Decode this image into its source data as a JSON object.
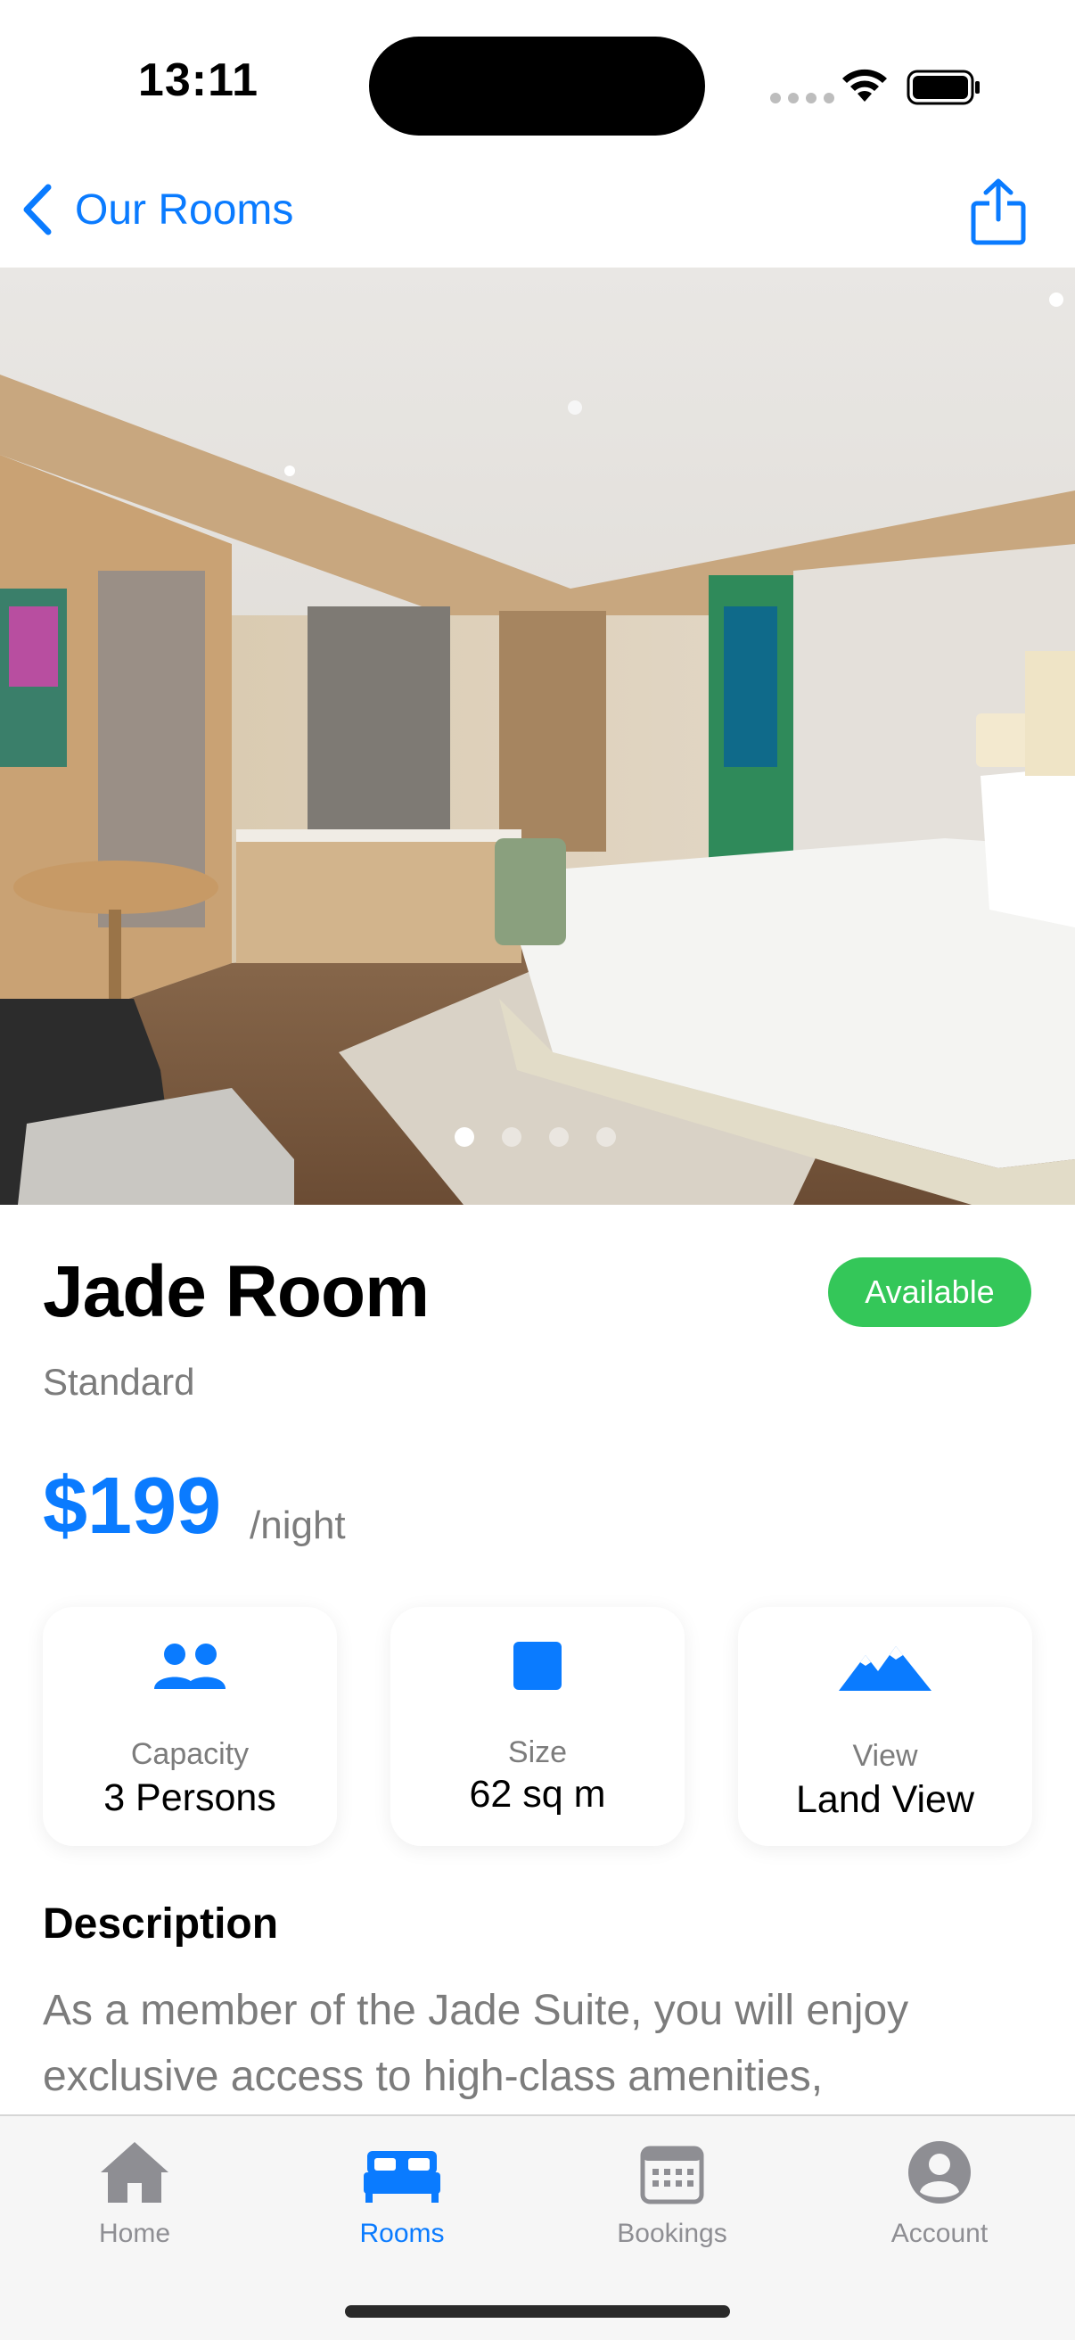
{
  "status_bar": {
    "time": "13:11"
  },
  "nav": {
    "back_label": "Our Rooms",
    "back_icon": "chevron-left-icon",
    "share_icon": "share-icon"
  },
  "hero": {
    "image": "hotel room photo",
    "page_count": 4,
    "current_page": 1
  },
  "room": {
    "name": "Jade Room",
    "status": "Available",
    "type": "Standard",
    "price": "$199",
    "price_unit": "/night"
  },
  "features": [
    {
      "icon": "people-icon",
      "caption": "Capacity",
      "value": "3 Persons"
    },
    {
      "icon": "square-icon",
      "caption": "Size",
      "value": "62 sq m"
    },
    {
      "icon": "mountains-icon",
      "caption": "View",
      "value": "Land View"
    }
  ],
  "description": {
    "title": "Description",
    "text": "As a member of the Jade Suite, you will enjoy exclusive access to high-class amenities,"
  },
  "tabs": [
    {
      "label": "Home",
      "icon": "house-icon",
      "active": false
    },
    {
      "label": "Rooms",
      "icon": "bed-icon",
      "active": true
    },
    {
      "label": "Bookings",
      "icon": "calendar-icon",
      "active": false
    },
    {
      "label": "Account",
      "icon": "person-circle-icon",
      "active": false
    }
  ],
  "colors": {
    "accent": "#0a7bff",
    "available": "#34c759",
    "secondary_text": "#7c7c7c"
  }
}
